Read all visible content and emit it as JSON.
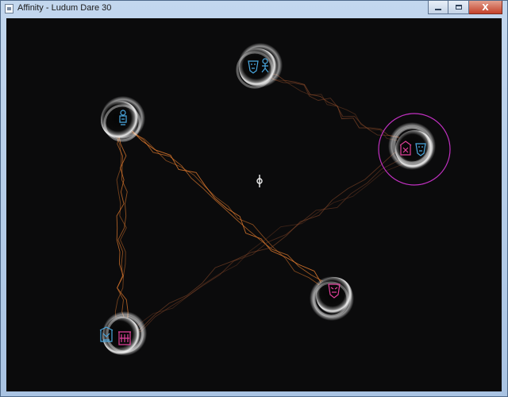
{
  "window": {
    "title": "Affinity - Ludum Dare 30",
    "controls": [
      "minimize",
      "maximize",
      "close"
    ],
    "close_glyph": "X"
  },
  "game": {
    "background": "#0b0b0c",
    "colors": {
      "link": "#e07a2e",
      "link_faint": "#8a4a2a",
      "blue_creature": "#4aa8e0",
      "pink_creature": "#e0409a",
      "selection_ring": "#c030c0"
    },
    "planets": [
      {
        "id": "top",
        "creatures": [
          "blue-mask",
          "blue-figure"
        ]
      },
      {
        "id": "upper-left",
        "creatures": [
          "blue-figure"
        ]
      },
      {
        "id": "right",
        "creatures": [
          "pink-house",
          "blue-mask"
        ],
        "selected": true
      },
      {
        "id": "lower-right",
        "creatures": [
          "pink-mask"
        ]
      },
      {
        "id": "bottom-left",
        "creatures": [
          "blue-house",
          "pink-house"
        ]
      }
    ],
    "cursor": "crosshair-cursor-icon"
  }
}
